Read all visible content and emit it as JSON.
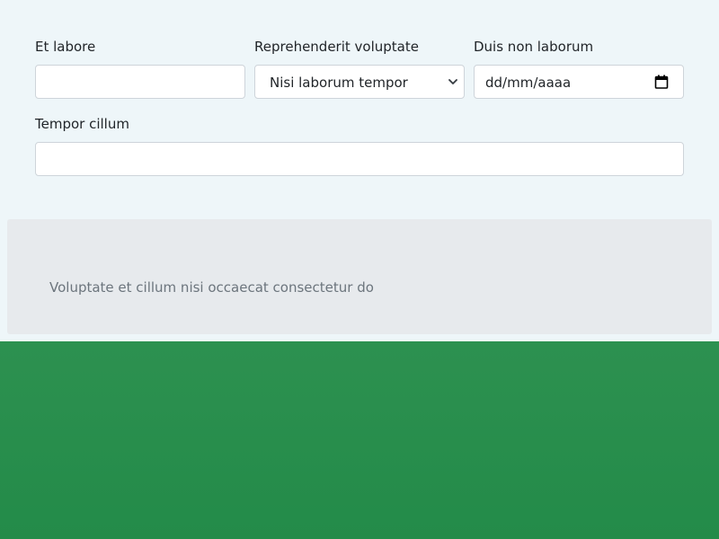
{
  "form": {
    "field1": {
      "label": "Et labore",
      "value": ""
    },
    "field2": {
      "label": "Reprehenderit voluptate",
      "selected": "Nisi laborum tempor"
    },
    "field3": {
      "label": "Duis non laborum",
      "placeholder": "dd/mm/aaaa"
    },
    "field4": {
      "label": "Tempor cillum",
      "value": ""
    }
  },
  "panel": {
    "text": "Voluptate et cillum nisi occaecat consectetur do"
  },
  "icons": {
    "select_arrow": "chevron-down-icon",
    "date_picker": "calendar-icon"
  },
  "colors": {
    "page_background": "#eef6f9",
    "panel_background": "#e7eaed",
    "footer_green": "#2d9150"
  }
}
